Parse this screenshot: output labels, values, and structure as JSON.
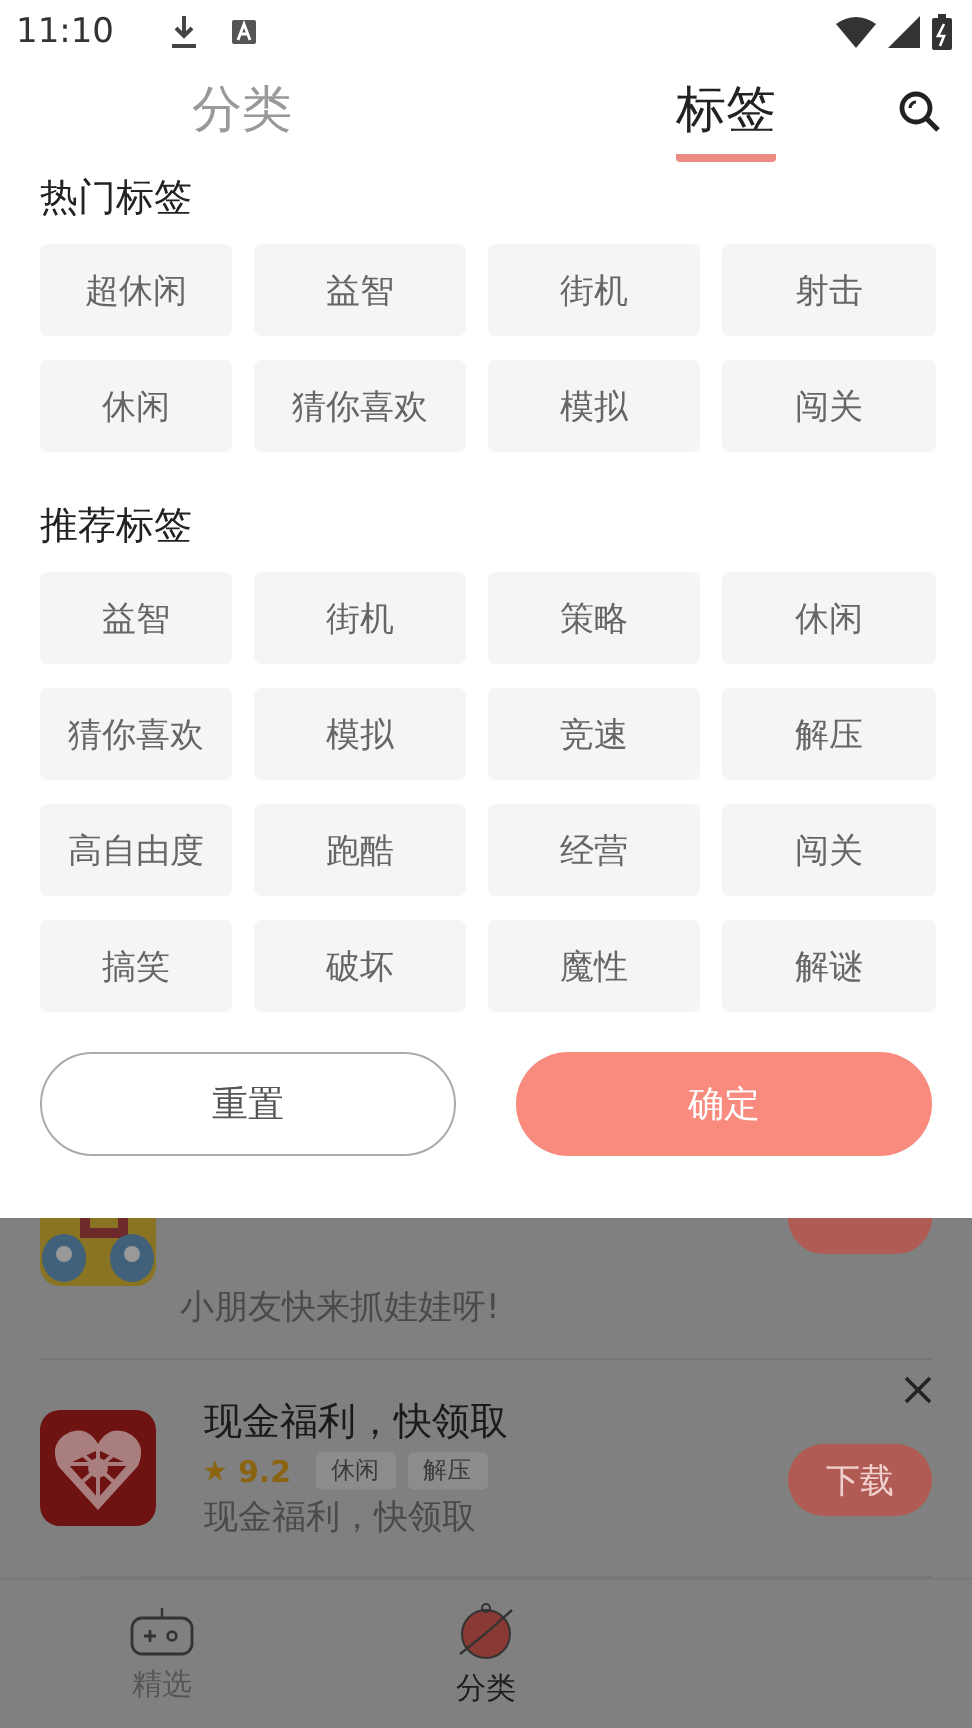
{
  "status_bar": {
    "time": "11:10"
  },
  "tabs": [
    {
      "label": "分类",
      "selected": false
    },
    {
      "label": "标签",
      "selected": true
    }
  ],
  "sections": [
    {
      "title": "热门标签",
      "tags": [
        "超休闲",
        "益智",
        "街机",
        "射击",
        "休闲",
        "猜你喜欢",
        "模拟",
        "闯关"
      ]
    },
    {
      "title": "推荐标签",
      "tags": [
        "益智",
        "街机",
        "策略",
        "休闲",
        "猜你喜欢",
        "模拟",
        "竞速",
        "解压",
        "高自由度",
        "跑酷",
        "经营",
        "闯关",
        "搞笑",
        "破坏",
        "魔性",
        "解谜"
      ]
    }
  ],
  "actions": {
    "reset": "重置",
    "confirm": "确定"
  },
  "background_list": [
    {
      "description": "小朋友快来抓娃娃呀!"
    },
    {
      "title": "现金福利，快领取",
      "rating": "9.2",
      "tags": [
        "休闲",
        "解压"
      ],
      "description": "现金福利，快领取",
      "button": "下载"
    }
  ],
  "bottom_nav": [
    {
      "label": "精选",
      "selected": false
    },
    {
      "label": "分类",
      "selected": true
    }
  ]
}
